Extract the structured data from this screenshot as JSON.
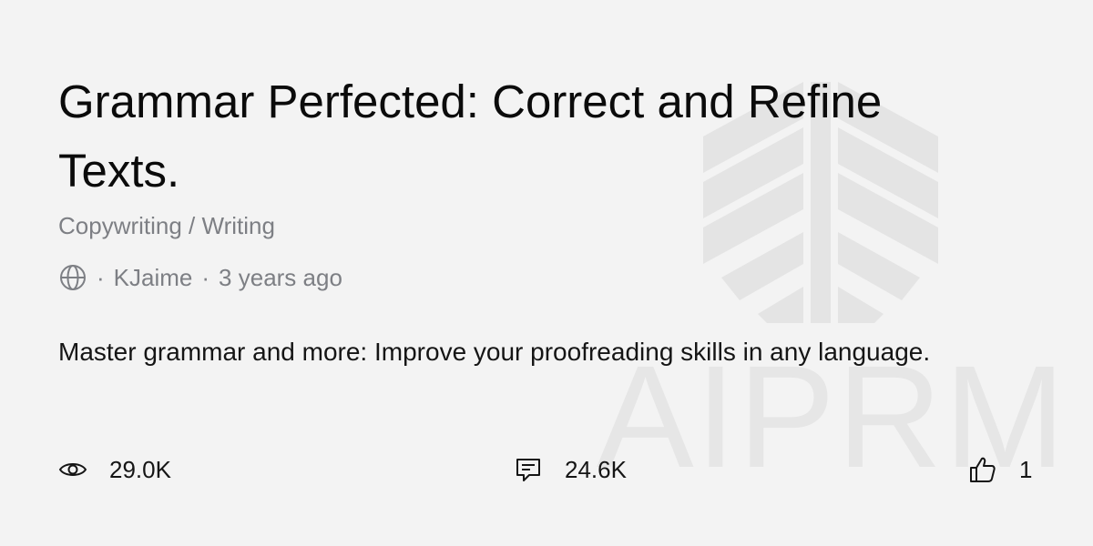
{
  "title": "Grammar Perfected: Correct and Refine Texts.",
  "category": "Copywriting / Writing",
  "meta": {
    "visibility_icon": "globe-icon",
    "separator": "·",
    "author": "KJaime",
    "time": "3 years ago"
  },
  "description": "Master grammar and more: Improve your proofreading skills in any language.",
  "stats": {
    "views": {
      "icon": "eye-icon",
      "value": "29.0K"
    },
    "comments": {
      "icon": "comment-icon",
      "value": "24.6K"
    },
    "likes": {
      "icon": "thumbs-up-icon",
      "value": "1"
    }
  },
  "watermark": {
    "text": "AIPRM",
    "color": "#e6e6e6"
  },
  "colors": {
    "background": "#f3f3f3",
    "text": "#111111",
    "muted": "#7d7f84"
  }
}
